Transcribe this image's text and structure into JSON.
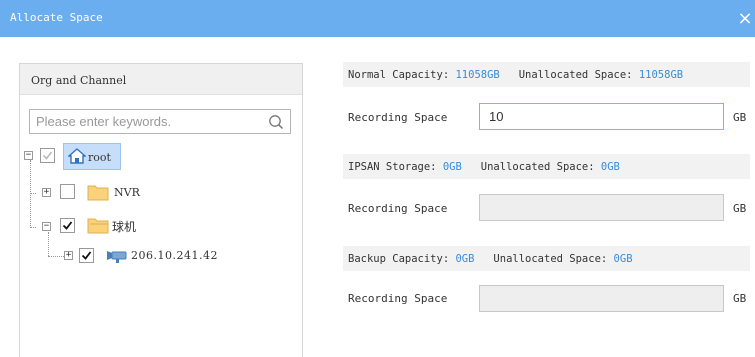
{
  "dialog": {
    "title": "Allocate Space",
    "close_glyph": "×"
  },
  "tree_panel": {
    "header": "Org and Channel",
    "search_placeholder": "Please enter keywords.",
    "nodes": [
      {
        "label": "root",
        "icon": "home-icon",
        "checked": "partial"
      },
      {
        "label": "NVR",
        "icon": "folder-icon",
        "checked": false
      },
      {
        "label": "球机",
        "icon": "folder-icon",
        "checked": true
      },
      {
        "label": "206.10.241.42",
        "icon": "camera-icon",
        "checked": true
      }
    ]
  },
  "normal": {
    "capacity_label": "Normal Capacity:",
    "capacity_value": "11058GB",
    "unallocated_label": "Unallocated Space:",
    "unallocated_value": "11058GB",
    "recording_label": "Recording Space",
    "recording_value": "10",
    "unit": "GB"
  },
  "ipsan": {
    "capacity_label": "IPSAN Storage:",
    "capacity_value": "0GB",
    "unallocated_label": "Unallocated Space:",
    "unallocated_value": "0GB",
    "recording_label": "Recording Space",
    "recording_value": "",
    "unit": "GB"
  },
  "backup": {
    "capacity_label": "Backup Capacity:",
    "capacity_value": "0GB",
    "unallocated_label": "Unallocated Space:",
    "unallocated_value": "0GB",
    "recording_label": "Recording Space",
    "recording_value": "",
    "unit": "GB"
  },
  "colors": {
    "titlebar": "#6aaef0",
    "accent_blue": "#3c8bd6",
    "active_border": "#f0a030"
  }
}
